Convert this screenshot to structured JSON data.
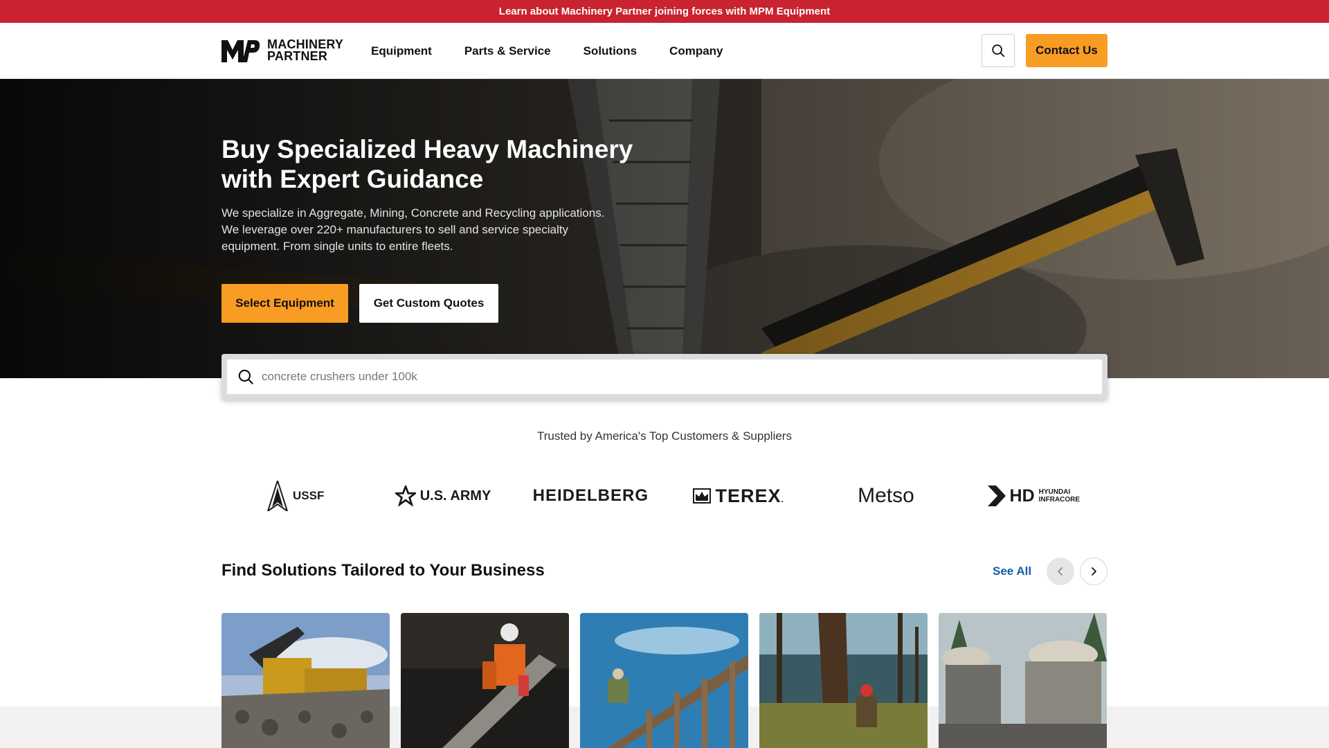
{
  "announcement": {
    "text": "Learn about Machinery Partner joining forces with MPM Equipment"
  },
  "brand": {
    "mark": "MP",
    "line1": "MACHINERY",
    "line2": "PARTNER"
  },
  "nav": {
    "items": [
      {
        "label": "Equipment"
      },
      {
        "label": "Parts & Service"
      },
      {
        "label": "Solutions"
      },
      {
        "label": "Company"
      }
    ],
    "search_icon": "search-icon",
    "contact_label": "Contact Us"
  },
  "hero": {
    "title": "Buy Specialized Heavy Machinery with Expert Guidance",
    "description": "We specialize in Aggregate, Mining, Concrete and Recycling applications. We leverage over 220+ manufacturers to sell and service specialty equipment. From single units to entire fleets.",
    "primary_button": "Select Equipment",
    "secondary_button": "Get Custom Quotes"
  },
  "search": {
    "value": "concrete crushers under 100k",
    "icon": "search-icon"
  },
  "trusted": {
    "heading": "Trusted by America's Top Customers & Suppliers",
    "logos": [
      {
        "name": "USSF",
        "icon": "delta-icon"
      },
      {
        "name": "U.S. ARMY",
        "icon": "star-icon"
      },
      {
        "name": "HEIDELBERG",
        "icon": ""
      },
      {
        "name": "TEREX",
        "icon": "terex-icon",
        "suffix": "."
      },
      {
        "name": "Metso",
        "icon": ""
      },
      {
        "name": "HD",
        "sub1": "HYUNDAI",
        "sub2": "INFRACORE",
        "icon": "hyundai-icon"
      }
    ]
  },
  "solutions": {
    "title": "Find Solutions Tailored to Your Business",
    "see_all": "See All",
    "prev_icon": "chevron-left-icon",
    "next_icon": "chevron-right-icon",
    "cards": [
      {
        "name": "excavator-on-rocks"
      },
      {
        "name": "concrete-worker"
      },
      {
        "name": "construction-frame"
      },
      {
        "name": "forestry-worker"
      },
      {
        "name": "dump-trucks"
      }
    ]
  },
  "colors": {
    "announcement_bg": "#c8232f",
    "accent": "#f89c24",
    "link": "#1559a8"
  }
}
